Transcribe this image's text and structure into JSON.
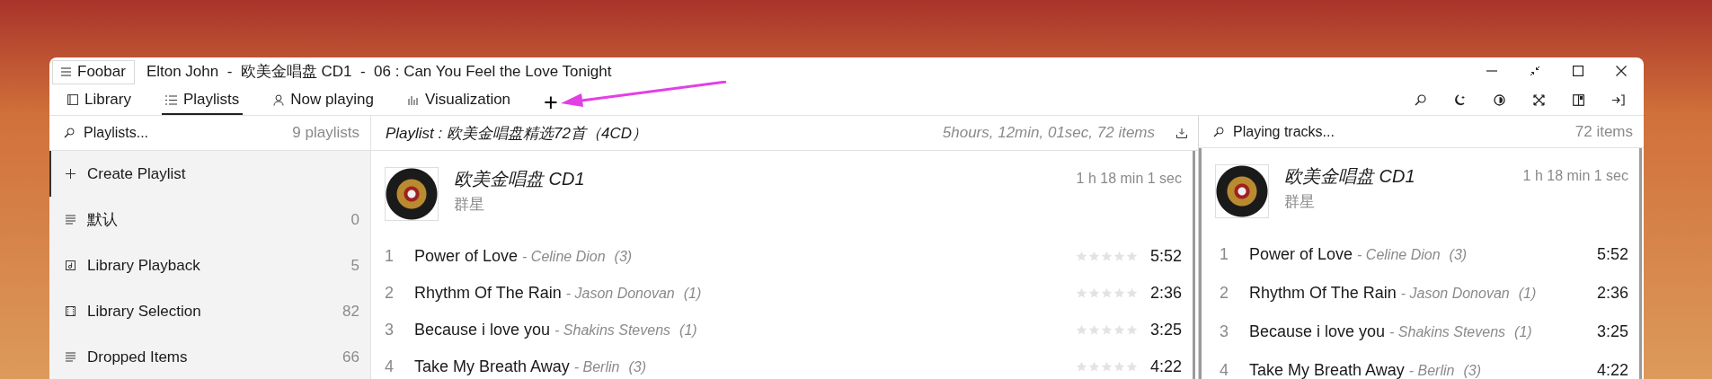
{
  "window": {
    "app_button": "Foobar",
    "title": "Elton John  -  欧美金唱盘 CD1  -  06 : Can You Feel the Love Tonight"
  },
  "tabs": [
    {
      "label": "Library",
      "kind": "library",
      "selected": false
    },
    {
      "label": "Playlists",
      "kind": "list",
      "selected": true
    },
    {
      "label": "Now playing",
      "kind": "person",
      "selected": false
    },
    {
      "label": "Visualization",
      "kind": "bars",
      "selected": false
    }
  ],
  "add_tab": "+",
  "playlists_panel": {
    "search_placeholder": "Playlists...",
    "count": "9 playlists",
    "items": [
      {
        "label": "Create Playlist",
        "kind": "action",
        "selected": true
      },
      {
        "label": "默认",
        "kind": "playlist",
        "count": "0",
        "selected": false
      },
      {
        "label": "Library Playback",
        "kind": "playback",
        "count": "5",
        "selected": false
      },
      {
        "label": "Library Selection",
        "kind": "selection",
        "count": "82",
        "selected": false
      },
      {
        "label": "Dropped Items",
        "kind": "playlist",
        "count": "66",
        "selected": false
      }
    ]
  },
  "playlist_panel": {
    "title": "Playlist : 欧美金唱盘精选72首（4CD）",
    "summary": "5hours, 12min, 01sec,  72 items",
    "album": {
      "title": "欧美金唱盘 CD1",
      "artist": "群星",
      "duration": "1 h 18 min 1 sec"
    },
    "tracks": [
      {
        "number": "1",
        "title": "Power of Love",
        "artist": "- Celine Dion",
        "plays": "(3)",
        "stars": 0,
        "time": "5:52"
      },
      {
        "number": "2",
        "title": "Rhythm Of The Rain",
        "artist": "- Jason Donovan",
        "plays": "(1)",
        "stars": 0,
        "time": "2:36"
      },
      {
        "number": "3",
        "title": "Because i love you",
        "artist": "- Shakins Stevens",
        "plays": "(1)",
        "stars": 0,
        "time": "3:25"
      },
      {
        "number": "4",
        "title": "Take My Breath Away",
        "artist": "- Berlin",
        "plays": "(3)",
        "stars": 0,
        "time": "4:22"
      }
    ]
  },
  "playing_panel": {
    "search_placeholder": "Playing tracks...",
    "count": "72 items",
    "album": {
      "title": "欧美金唱盘 CD1",
      "artist": "群星",
      "duration": "1 h 18 min 1 sec"
    },
    "tracks": [
      {
        "number": "1",
        "title": "Power of Love",
        "artist": "- Celine Dion",
        "plays": "(3)",
        "time": "5:52"
      },
      {
        "number": "2",
        "title": "Rhythm Of The Rain",
        "artist": "- Jason Donovan",
        "plays": "(1)",
        "time": "2:36"
      },
      {
        "number": "3",
        "title": "Because i love you",
        "artist": "- Shakins Stevens",
        "plays": "(1)",
        "time": "3:25"
      },
      {
        "number": "4",
        "title": "Take My Breath Away",
        "artist": "- Berlin",
        "plays": "(3)",
        "time": "4:22"
      }
    ]
  }
}
